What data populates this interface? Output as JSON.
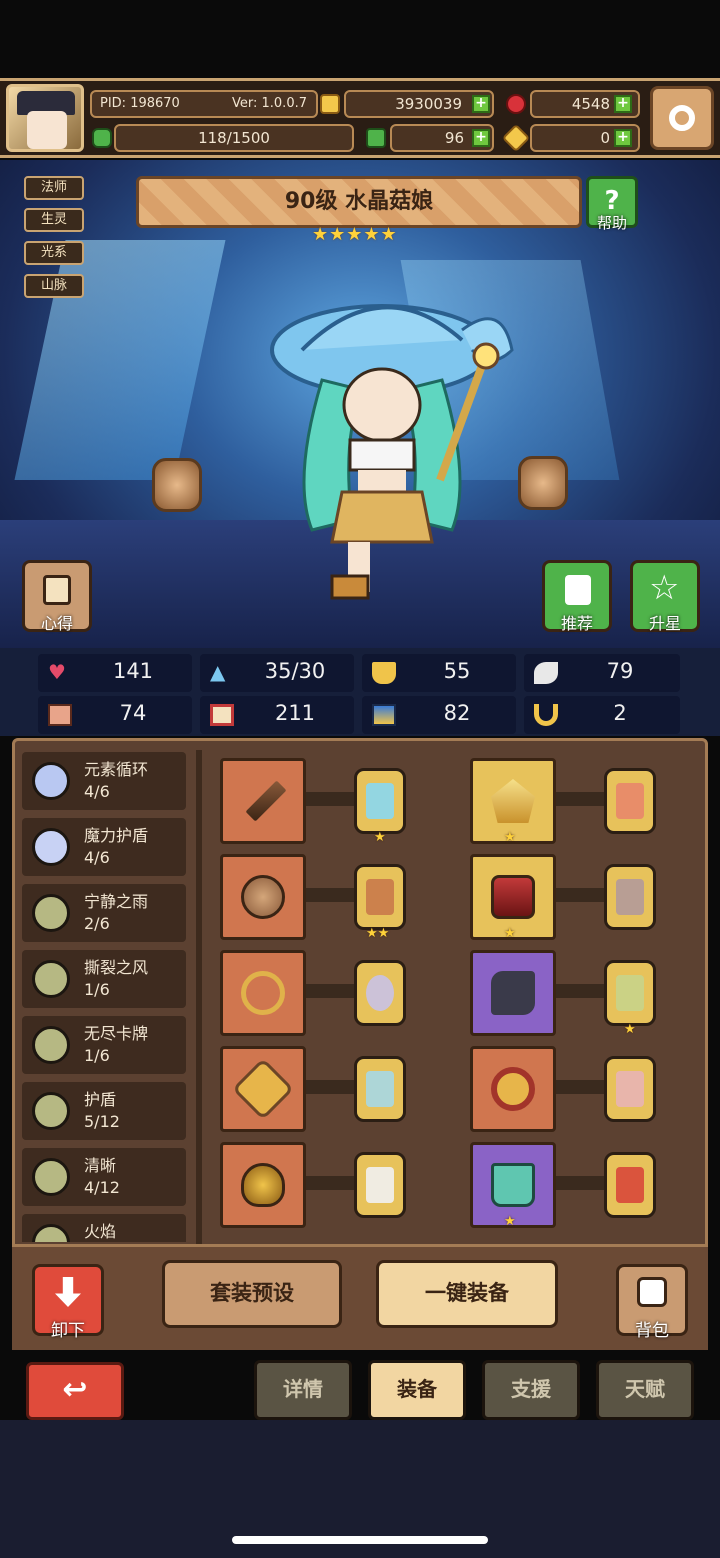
{
  "topbar": {
    "pid_label": "PID: 198670",
    "version_label": "Ver: 1.0.0.7",
    "energy_value": "118/1500",
    "gold_value": "3930039",
    "ruby_value": "4548",
    "clover_value": "96",
    "key_value": "0"
  },
  "tags": [
    "法师",
    "生灵",
    "光系",
    "山脉"
  ],
  "hero": {
    "title": "90级  水晶菇娘",
    "stars": "★★★★★",
    "help_label": "帮助",
    "xinde_label": "心得",
    "tuijian_label": "推荐",
    "shengxing_label": "升星"
  },
  "stats": {
    "hp": "141",
    "mana": "35/30",
    "shield": "55",
    "speed": "79",
    "attack": "74",
    "magic": "211",
    "defense": "82",
    "luck": "2"
  },
  "skills": [
    {
      "name": "元素循环",
      "count": "4/6"
    },
    {
      "name": "魔力护盾",
      "count": "4/6"
    },
    {
      "name": "宁静之雨",
      "count": "2/6"
    },
    {
      "name": "撕裂之风",
      "count": "1/6"
    },
    {
      "name": "无尽卡牌",
      "count": "1/6"
    },
    {
      "name": "护盾",
      "count": "5/12"
    },
    {
      "name": "清晰",
      "count": "4/12"
    },
    {
      "name": "火焰",
      "count": ""
    }
  ],
  "actions": {
    "unequip_label": "卸下",
    "preset_label": "套装预设",
    "equip_all_label": "一键装备",
    "bag_label": "背包"
  },
  "tabs": {
    "details": "详情",
    "equipment": "装备",
    "support": "支援",
    "talent": "天赋"
  },
  "colors": {
    "hp": "#e44b6a",
    "mana": "#7cc8f0",
    "shield": "#f0c44a",
    "gold": "#f3c84b",
    "ruby": "#d8323a"
  }
}
